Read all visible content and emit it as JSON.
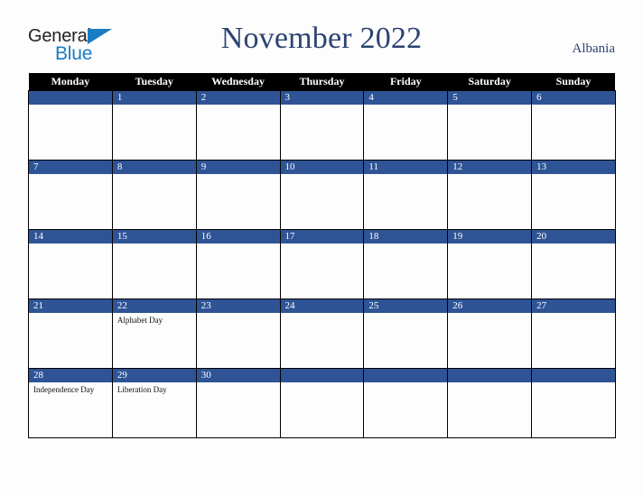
{
  "brand": {
    "name_part1": "General",
    "name_part2": "Blue",
    "triangle_color": "#1a7cc2"
  },
  "header": {
    "title": "November 2022",
    "country": "Albania"
  },
  "colors": {
    "header_row_bg": "#000000",
    "day_bar_bg": "#2f5496",
    "title_color": "#2c4372",
    "page_bg": "#fdfdfd",
    "grid_border": "#000000"
  },
  "calendar": {
    "month": "November",
    "year": "2022",
    "weekday_headers": [
      "Monday",
      "Tuesday",
      "Wednesday",
      "Thursday",
      "Friday",
      "Saturday",
      "Sunday"
    ],
    "weeks": [
      [
        {
          "day": "",
          "events": []
        },
        {
          "day": "1",
          "events": []
        },
        {
          "day": "2",
          "events": []
        },
        {
          "day": "3",
          "events": []
        },
        {
          "day": "4",
          "events": []
        },
        {
          "day": "5",
          "events": []
        },
        {
          "day": "6",
          "events": []
        }
      ],
      [
        {
          "day": "7",
          "events": []
        },
        {
          "day": "8",
          "events": []
        },
        {
          "day": "9",
          "events": []
        },
        {
          "day": "10",
          "events": []
        },
        {
          "day": "11",
          "events": []
        },
        {
          "day": "12",
          "events": []
        },
        {
          "day": "13",
          "events": []
        }
      ],
      [
        {
          "day": "14",
          "events": []
        },
        {
          "day": "15",
          "events": []
        },
        {
          "day": "16",
          "events": []
        },
        {
          "day": "17",
          "events": []
        },
        {
          "day": "18",
          "events": []
        },
        {
          "day": "19",
          "events": []
        },
        {
          "day": "20",
          "events": []
        }
      ],
      [
        {
          "day": "21",
          "events": []
        },
        {
          "day": "22",
          "events": [
            "Alphabet Day"
          ]
        },
        {
          "day": "23",
          "events": []
        },
        {
          "day": "24",
          "events": []
        },
        {
          "day": "25",
          "events": []
        },
        {
          "day": "26",
          "events": []
        },
        {
          "day": "27",
          "events": []
        }
      ],
      [
        {
          "day": "28",
          "events": [
            "Independence Day"
          ]
        },
        {
          "day": "29",
          "events": [
            "Liberation Day"
          ]
        },
        {
          "day": "30",
          "events": []
        },
        {
          "day": "",
          "events": []
        },
        {
          "day": "",
          "events": []
        },
        {
          "day": "",
          "events": []
        },
        {
          "day": "",
          "events": []
        }
      ]
    ]
  }
}
